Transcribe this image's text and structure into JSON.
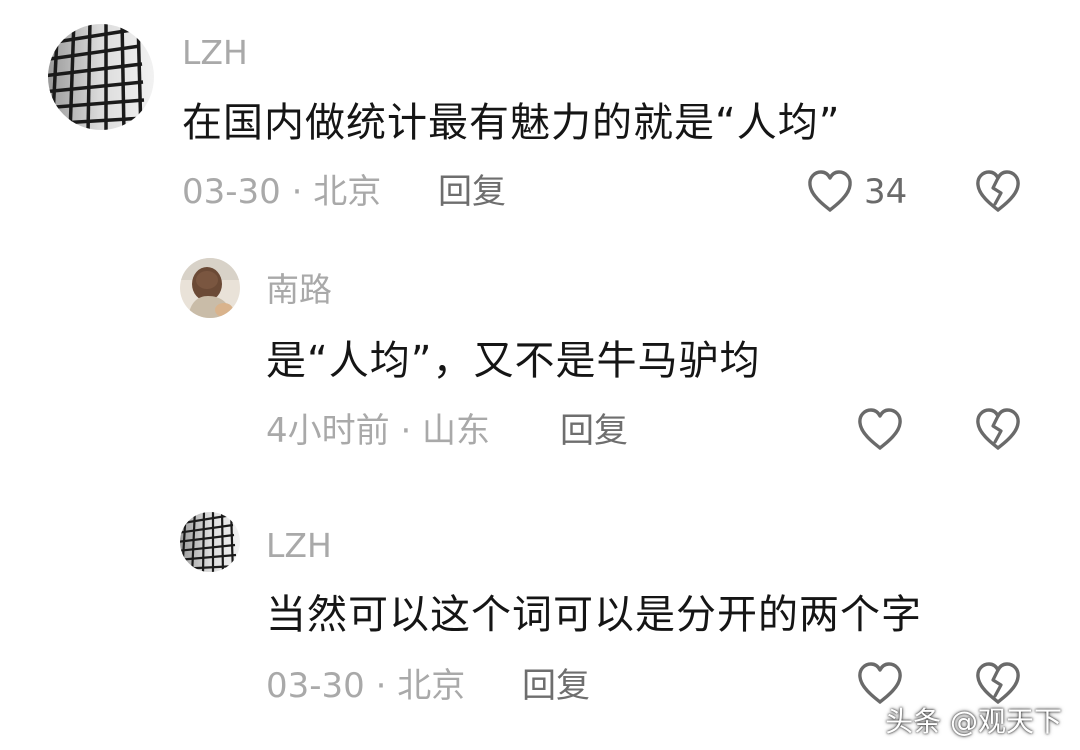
{
  "comments": [
    {
      "username": "LZH",
      "text": "在国内做统计最有魅力的就是“人均”",
      "meta": "03-30 · 北京",
      "reply_label": "回复",
      "likes": "34"
    },
    {
      "username": "南路",
      "text": "是“人均”，又不是牛马驴均",
      "meta": "4小时前 · 山东",
      "reply_label": "回复",
      "likes": ""
    },
    {
      "username": "LZH",
      "text": "当然可以这个词可以是分开的两个字",
      "meta": "03-30 · 北京",
      "reply_label": "回复",
      "likes": ""
    }
  ],
  "watermark": "头条 @观天下",
  "colors": {
    "username": "#a9a9a9",
    "content": "#151515",
    "meta": "#a9a9a9",
    "reply": "#6e6e6e",
    "icon": "#6a6a6a"
  },
  "icons": {
    "like": "heart-outline-icon",
    "dislike": "broken-heart-icon"
  }
}
